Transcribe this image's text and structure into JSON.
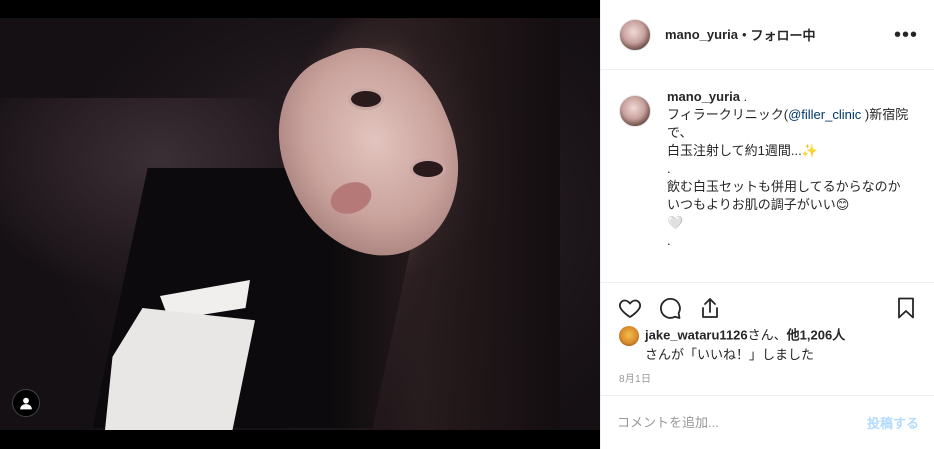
{
  "post": {
    "username": "mano_yuria",
    "separator": "•",
    "follow_status": "フォロー中",
    "more_icon": "more-horizontal-icon"
  },
  "caption": {
    "username": "mano_yuria",
    "line1_after_user": " .",
    "line2_prefix": "フィラークリニック(",
    "mention": "@filler_clinic",
    "line2_suffix": " )新宿院で、",
    "line3": "白玉注射して約1週間...✨",
    "line4": ".",
    "line5": "飲む白玉セットも併用してるからなのか",
    "line6": "いつもよりお肌の調子がいい😊",
    "line7": "🤍",
    "line8": "."
  },
  "actions": {
    "like_icon": "heart-icon",
    "comment_icon": "comment-icon",
    "share_icon": "share-icon",
    "save_icon": "bookmark-icon"
  },
  "likes": {
    "user": "jake_wataru1126",
    "mid": "さん、",
    "others": "他1,206人",
    "line2": "さんが「いいね！」しました"
  },
  "date": "8月1日",
  "comment_box": {
    "placeholder": "コメントを追加...",
    "post_label": "投稿する"
  }
}
